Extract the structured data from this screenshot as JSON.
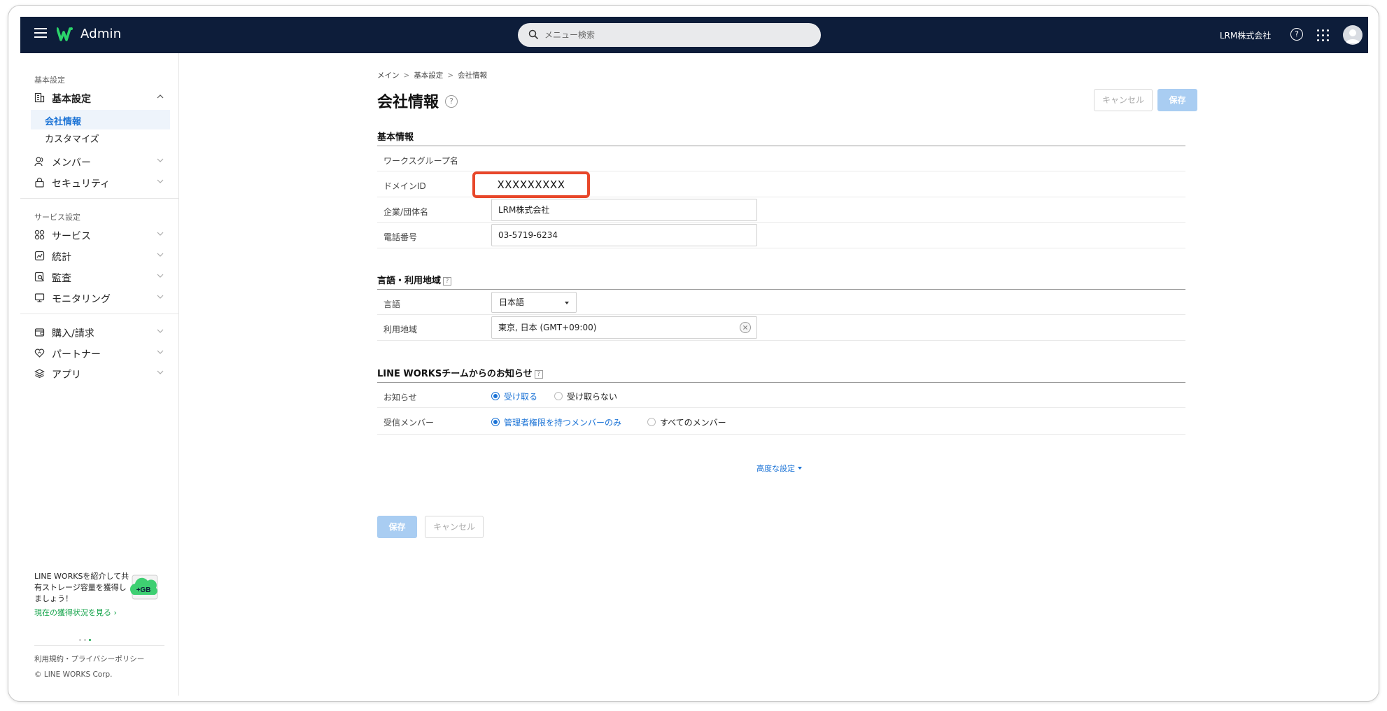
{
  "topbar": {
    "logo_text": "Admin",
    "search_placeholder": "メニュー検索",
    "company": "LRM株式会社",
    "help": "?"
  },
  "sidebar": {
    "section1": "基本設定",
    "basic": "基本設定",
    "company_info": "会社情報",
    "customize": "カスタマイズ",
    "member": "メンバー",
    "security": "セキュリティ",
    "section2": "サービス設定",
    "service": "サービス",
    "stats": "統計",
    "audit": "監査",
    "monitoring": "モニタリング",
    "purchase": "購入/請求",
    "partner": "パートナー",
    "apps": "アプリ",
    "promo_text": "LINE WORKSを紹介して共有ストレージ容量を獲得しましょう！",
    "promo_badge": "+GB",
    "promo_link": "現在の獲得状況を見る ›",
    "footer_links": "利用規約・プライバシーポリシー",
    "copyright": "© LINE WORKS Corp.",
    "accent": "#1b73d6"
  },
  "main": {
    "breadcrumb": [
      "メイン",
      "基本設定",
      "会社情報"
    ],
    "breadcrumb_sep": ">",
    "title": "会社情報",
    "title_help": "?",
    "cancel": "キャンセル",
    "save": "保存",
    "basic_section": "基本情報",
    "workgroup_label": "ワークスグループ名",
    "domain_label": "ドメインID",
    "domain_value": "XXXXXXXXX",
    "company_label": "企業/団体名",
    "company_value": "LRM株式会社",
    "phone_label": "電話番号",
    "phone_value": "03-5719-6234",
    "lang_section": "言語・利用地域",
    "lang_label": "言語",
    "lang_value": "日本語",
    "region_label": "利用地域",
    "region_value": "東京, 日本 (GMT+09:00)",
    "notice_section": "LINE WORKSチームからのお知らせ",
    "notice_label": "お知らせ",
    "notice_on": "受け取る",
    "notice_off": "受け取らない",
    "recipients_label": "受信メンバー",
    "recipients_admin": "管理者権限を持つメンバーのみ",
    "recipients_all": "すべてのメンバー",
    "advanced": "高度な設定",
    "bottom_save": "保存",
    "bottom_cancel": "キャンセル"
  }
}
